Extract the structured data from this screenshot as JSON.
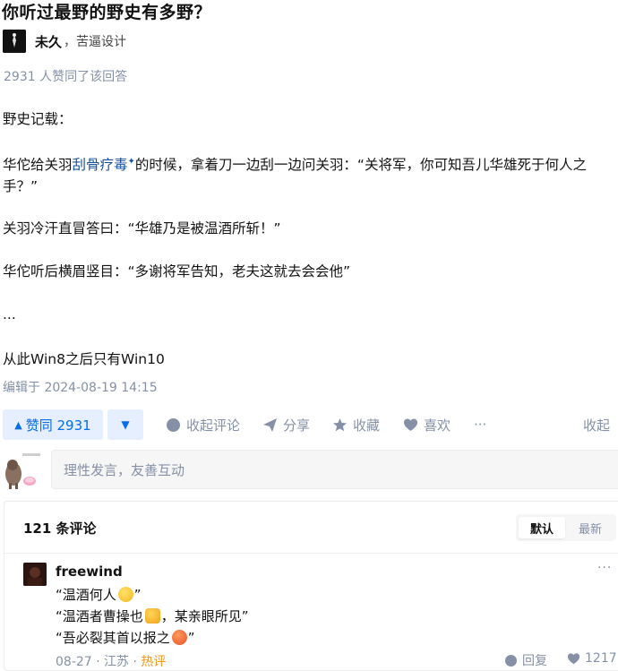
{
  "question": {
    "title": "你听过最野的野史有多野？"
  },
  "author": {
    "name": "未久",
    "bio": "，苦逼设计"
  },
  "answer": {
    "voters_text": "2931 人赞同了该回答",
    "paragraph1": "野史记载：",
    "p2_before": "华佗给关羽",
    "p2_link": "刮骨疗毒",
    "p2_after": "的时候，拿着刀一边刮一边问关羽：“关将军，你可知吾儿华雄死于何人之手？”",
    "paragraph3": "关羽冷汗直冒答曰：“华雄乃是被温酒所斩！”",
    "paragraph4": "华佗听后横眉竖目：“多谢将军告知，老夫这就去会会他”",
    "paragraph5": "...",
    "paragraph6": "从此Win8之后只有Win10",
    "edited": "编辑于 2024-08-19 14:15"
  },
  "actions": {
    "upvote": "赞同 2931",
    "collapse_comments": "收起评论",
    "share": "分享",
    "favorite": "收藏",
    "like": "喜欢",
    "more": "···",
    "collapse": "收起"
  },
  "comment_input": {
    "placeholder": "理性发言，友善互动"
  },
  "comments": {
    "count_label": "121 条评论",
    "sort_default": "默认",
    "sort_newest": "最新",
    "items": [
      {
        "author": "freewind",
        "line1": "“温酒何人",
        "line1_end": "”",
        "line2": "“温酒者曹操也",
        "line2_end": "，某亲眼所见”",
        "line3": "“吾必裂其首以报之",
        "line3_end": "”",
        "date": "08-27",
        "location": "江苏",
        "hot": "热评",
        "reply": "回复",
        "likes": "1217",
        "more": "···"
      }
    ]
  },
  "colors": {
    "accent": "#056de8",
    "link": "#175199",
    "muted": "#8590a6",
    "hot": "#f1941a"
  },
  "icons": [
    "comment-icon",
    "share-icon",
    "star-icon",
    "heart-icon",
    "reply-icon",
    "like-icon"
  ]
}
